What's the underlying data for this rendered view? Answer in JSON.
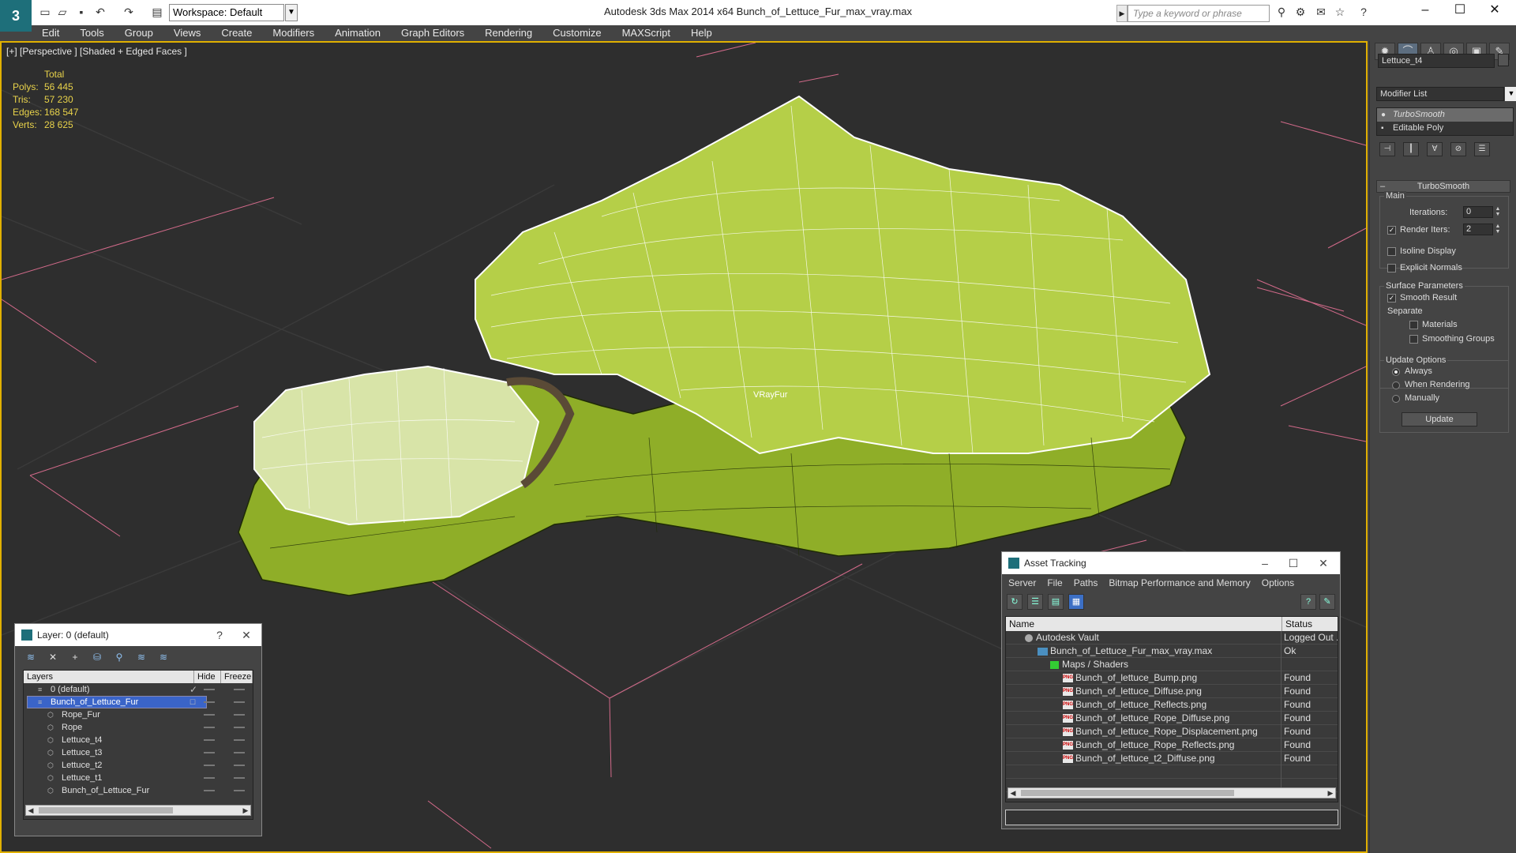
{
  "titlebar": {
    "workspace": "Workspace: Default",
    "title": "Autodesk 3ds Max  2014 x64       Bunch_of_Lettuce_Fur_max_vray.max",
    "search_placeholder": "Type a keyword or phrase"
  },
  "menu": [
    "Edit",
    "Tools",
    "Group",
    "Views",
    "Create",
    "Modifiers",
    "Animation",
    "Graph Editors",
    "Rendering",
    "Customize",
    "MAXScript",
    "Help"
  ],
  "viewport": {
    "label": "[+] [Perspective ] [Shaded + Edged Faces ]",
    "stats_header": "Total",
    "stats": [
      {
        "key": "Polys:",
        "value": "56 445"
      },
      {
        "key": "Tris:",
        "value": "57 230"
      },
      {
        "key": "Edges:",
        "value": "168 547"
      },
      {
        "key": "Verts:",
        "value": "28 625"
      }
    ],
    "gizmo_label": "VRayFur"
  },
  "command_panel": {
    "object_name": "Lettuce_t4",
    "modifier_list": "Modifier List",
    "stack": [
      "TurboSmooth",
      "Editable Poly"
    ],
    "rollout_title": "TurboSmooth",
    "main_group": "Main",
    "iterations_label": "Iterations:",
    "iterations_value": "0",
    "render_iters_label": "Render Iters:",
    "render_iters_value": "2",
    "isoline_label": "Isoline Display",
    "explicit_normals_label": "Explicit Normals",
    "surface_group": "Surface Parameters",
    "smooth_result_label": "Smooth Result",
    "separate_label": "Separate",
    "materials_label": "Materials",
    "smoothing_groups_label": "Smoothing Groups",
    "update_group": "Update Options",
    "always_label": "Always",
    "when_rendering_label": "When Rendering",
    "manually_label": "Manually",
    "update_button": "Update"
  },
  "layer_window": {
    "title": "Layer: 0 (default)",
    "help": "?",
    "col_layers": "Layers",
    "col_hide": "Hide",
    "col_freeze": "Freeze",
    "rows": [
      {
        "name": "0 (default)",
        "indent": 0,
        "selected": false,
        "checked": true
      },
      {
        "name": "Bunch_of_Lettuce_Fur",
        "indent": 0,
        "selected": true,
        "checked": false
      },
      {
        "name": "Rope_Fur",
        "indent": 1,
        "selected": false,
        "checked": false
      },
      {
        "name": "Rope",
        "indent": 1,
        "selected": false,
        "checked": false
      },
      {
        "name": "Lettuce_t4",
        "indent": 1,
        "selected": false,
        "checked": false
      },
      {
        "name": "Lettuce_t3",
        "indent": 1,
        "selected": false,
        "checked": false
      },
      {
        "name": "Lettuce_t2",
        "indent": 1,
        "selected": false,
        "checked": false
      },
      {
        "name": "Lettuce_t1",
        "indent": 1,
        "selected": false,
        "checked": false
      },
      {
        "name": "Bunch_of_Lettuce_Fur",
        "indent": 1,
        "selected": false,
        "checked": false
      }
    ]
  },
  "asset_window": {
    "title": "Asset Tracking",
    "menu": [
      "Server",
      "File",
      "Paths",
      "Bitmap Performance and Memory",
      "Options"
    ],
    "col_name": "Name",
    "col_status": "Status",
    "rows": [
      {
        "name": "Autodesk Vault",
        "status": "Logged Out ...",
        "level": 0,
        "icon": "vault"
      },
      {
        "name": "Bunch_of_Lettuce_Fur_max_vray.max",
        "status": "Ok",
        "level": 1,
        "icon": "max"
      },
      {
        "name": "Maps / Shaders",
        "status": "",
        "level": 2,
        "icon": "folder"
      },
      {
        "name": "Bunch_of_lettuce_Bump.png",
        "status": "Found",
        "level": 3,
        "icon": "png"
      },
      {
        "name": "Bunch_of_lettuce_Diffuse.png",
        "status": "Found",
        "level": 3,
        "icon": "png"
      },
      {
        "name": "Bunch_of_lettuce_Reflects.png",
        "status": "Found",
        "level": 3,
        "icon": "png"
      },
      {
        "name": "Bunch_of_lettuce_Rope_Diffuse.png",
        "status": "Found",
        "level": 3,
        "icon": "png"
      },
      {
        "name": "Bunch_of_lettuce_Rope_Displacement.png",
        "status": "Found",
        "level": 3,
        "icon": "png"
      },
      {
        "name": "Bunch_of_lettuce_Rope_Reflects.png",
        "status": "Found",
        "level": 3,
        "icon": "png"
      },
      {
        "name": "Bunch_of_lettuce_t2_Diffuse.png",
        "status": "Found",
        "level": 3,
        "icon": "png"
      }
    ]
  },
  "colors": {
    "stats_text": "#e8d24a",
    "viewport_border": "#e0b000",
    "selection": "#3a64c8",
    "lettuce": "#a8c832",
    "grid_line": "#d26a8a"
  }
}
